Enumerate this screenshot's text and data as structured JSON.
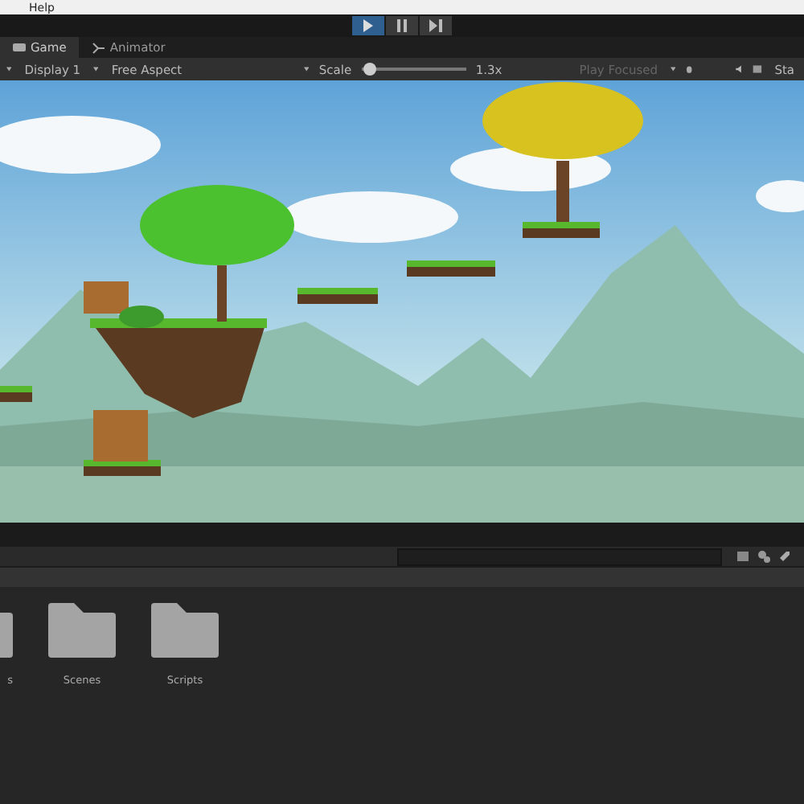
{
  "menu_bar": {
    "items": [
      "Help"
    ]
  },
  "play_controls": [
    {
      "kind": "play",
      "selected": true
    },
    {
      "kind": "pause",
      "selected": false
    },
    {
      "kind": "step",
      "selected": false
    }
  ],
  "tabs": [
    {
      "label": "Game",
      "kind": "game",
      "selected": true
    },
    {
      "label": "Animator",
      "kind": "animator",
      "selected": false
    }
  ],
  "game_toolbar": {
    "display": "Display 1",
    "aspect": "Free Aspect",
    "scale_label": "Scale",
    "scale": {
      "level": 0.02
    },
    "scale_value": "1.3x",
    "play_mode": "Play Focused",
    "stats": "Sta"
  },
  "project": {
    "folders": [
      {
        "name": "s"
      },
      {
        "name": "Scenes"
      },
      {
        "name": "Scripts"
      }
    ]
  }
}
